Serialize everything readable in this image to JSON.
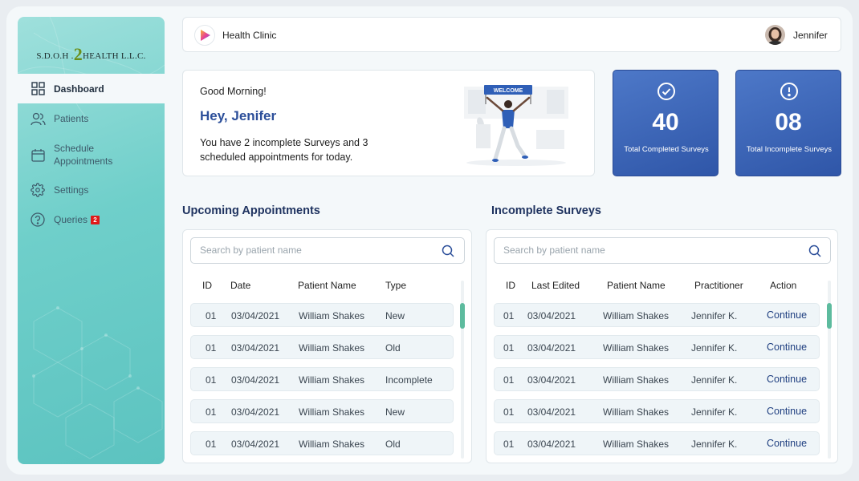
{
  "sidebar": {
    "logo_left": "S.D.O.H .",
    "logo_num": "2",
    "logo_right": "HEALTH L.L.C.",
    "items": [
      {
        "label": "Dashboard",
        "icon": "grid-icon",
        "active": true
      },
      {
        "label": "Patients",
        "icon": "users-icon"
      },
      {
        "label": "Schedule Appointments",
        "icon": "calendar-icon"
      },
      {
        "label": "Settings",
        "icon": "gear-icon"
      },
      {
        "label": "Queries",
        "icon": "question-icon",
        "badge": "2"
      }
    ]
  },
  "header": {
    "clinic_name": "Health Clinic",
    "user_name": "Jennifer"
  },
  "welcome": {
    "greeting": "Good Morning!",
    "hey": "Hey, Jenifer",
    "message": "You have 2 incomplete Surveys and 3 scheduled appointments for today.",
    "banner": "WELCOME"
  },
  "stats": [
    {
      "value": "40",
      "label": "Total Completed Surveys",
      "icon": "check-circle-icon"
    },
    {
      "value": "08",
      "label": "Total Incomplete Surveys",
      "icon": "alert-circle-icon"
    }
  ],
  "appointments": {
    "title": "Upcoming Appointments",
    "search_placeholder": "Search by patient name",
    "columns": [
      "ID",
      "Date",
      "Patient Name",
      "Type"
    ],
    "rows": [
      [
        "01",
        "03/04/2021",
        "William Shakes",
        "New"
      ],
      [
        "01",
        "03/04/2021",
        "William Shakes",
        "Old"
      ],
      [
        "01",
        "03/04/2021",
        "William Shakes",
        "Incomplete"
      ],
      [
        "01",
        "03/04/2021",
        "William Shakes",
        "New"
      ],
      [
        "01",
        "03/04/2021",
        "William Shakes",
        "Old"
      ]
    ]
  },
  "surveys": {
    "title": "Incomplete Surveys",
    "search_placeholder": "Search by patient name",
    "columns": [
      "ID",
      "Last Edited",
      "Patient Name",
      "Practitioner",
      "Action"
    ],
    "rows": [
      [
        "01",
        "03/04/2021",
        "William Shakes",
        "Jennifer K.",
        "Continue"
      ],
      [
        "01",
        "03/04/2021",
        "William Shakes",
        "Jennifer K.",
        "Continue"
      ],
      [
        "01",
        "03/04/2021",
        "William Shakes",
        "Jennifer K.",
        "Continue"
      ],
      [
        "01",
        "03/04/2021",
        "William Shakes",
        "Jennifer K.",
        "Continue"
      ],
      [
        "01",
        "03/04/2021",
        "William Shakes",
        "Jennifer K.",
        "Continue"
      ]
    ]
  },
  "colors": {
    "accent": "#2c4f9a",
    "sidebar": "#6fcfca",
    "stat_card": "#3a63b8",
    "scroll_thumb": "#5dbb9e",
    "badge": "#e01919"
  }
}
